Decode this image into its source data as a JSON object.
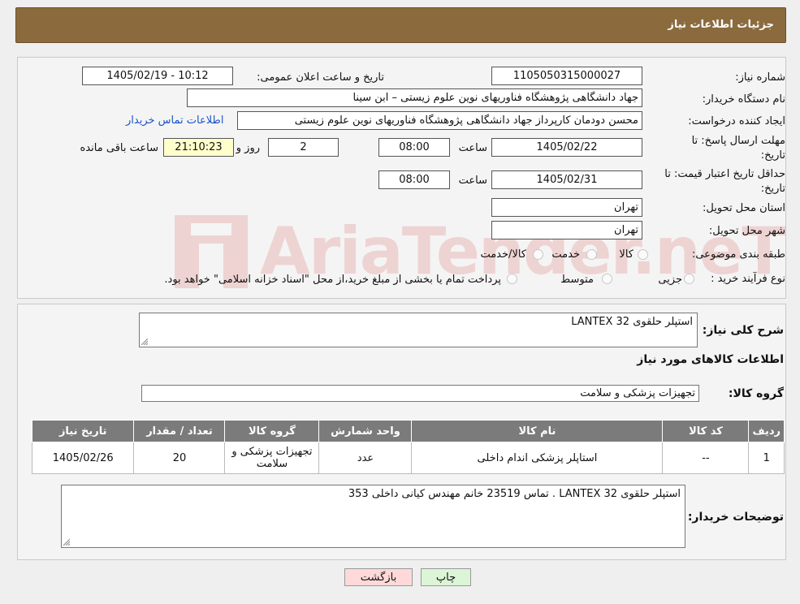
{
  "header": {
    "title": "جزئیات اطلاعات نیاز"
  },
  "fields": {
    "need_number_label": "شماره نیاز:",
    "need_number": "1105050315000027",
    "announce_label": "تاریخ و ساعت اعلان عمومی:",
    "announce_value": "1405/02/19 - 10:12",
    "buyer_org_label": "نام دستگاه خریدار:",
    "buyer_org": "جهاد دانشگاهی پژوهشگاه فناوریهای نوین علوم زیستی – ابن سینا",
    "creator_label": "ایجاد کننده درخواست:",
    "creator": "محسن دودمان کارپرداز جهاد دانشگاهی پژوهشگاه فناوریهای نوین علوم زیستی",
    "contact_link": "اطلاعات تماس خریدار",
    "reply_deadline_label_1": "مهلت ارسال پاسخ: تا",
    "reply_deadline_label_2": "تاریخ:",
    "reply_date": "1405/02/22",
    "time_label": "ساعت",
    "reply_time": "08:00",
    "days_value": "2",
    "days_label": "روز و",
    "remaining_time": "21:10:23",
    "remaining_label": "ساعت باقی مانده",
    "price_validity_label_1": "حداقل تاریخ اعتبار قیمت: تا",
    "price_validity_label_2": "تاریخ:",
    "validity_date": "1405/02/31",
    "validity_time": "08:00",
    "province_label": "استان محل تحویل:",
    "province": "تهران",
    "city_label": "شهر محل تحویل:",
    "city": "تهران",
    "category_label": "طبقه بندی موضوعی:",
    "category_options": [
      "کالا",
      "خدمت",
      "کالا/خدمت"
    ],
    "process_label": "نوع فرآیند خرید :",
    "process_options": [
      "جزیی",
      "متوسط"
    ],
    "process_note": "پرداخت تمام یا بخشی از مبلغ خرید،از محل \"اسناد خزانه اسلامی\" خواهد بود."
  },
  "description": {
    "label": "شرح کلی نیاز:",
    "value": "استپلر حلقوی LANTEX 32",
    "items_title": "اطلاعات کالاهای مورد نیاز",
    "group_label": "گروه کالا:",
    "group_value": "تجهیزات پزشکی و سلامت"
  },
  "table": {
    "headers": [
      "ردیف",
      "کد کالا",
      "نام کالا",
      "واحد شمارش",
      "گروه کالا",
      "تعداد / مقدار",
      "تاریخ نیاز"
    ],
    "rows": [
      [
        "1",
        "--",
        "استاپلر پزشکی اندام داخلی",
        "عدد",
        "تجهیزات پزشکی و سلامت",
        "20",
        "1405/02/26"
      ]
    ]
  },
  "buyer_notes": {
    "label": "توضیحات خریدار:",
    "value": "استپلر حلقوی LANTEX 32 . تماس 23519 خانم مهندس کیانی داخلی 353"
  },
  "buttons": {
    "print": "چاپ",
    "back": "بازگشت"
  },
  "watermark": {
    "text": "AriaTender.neT"
  }
}
